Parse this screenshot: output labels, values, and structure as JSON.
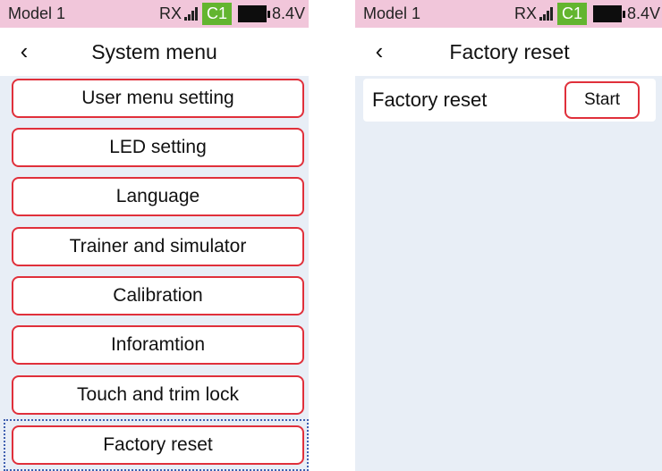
{
  "status": {
    "model": "Model 1",
    "rx": "RX",
    "channel": "C1",
    "voltage": "8.4V",
    "signal_icon": "signal-bars-icon",
    "battery_icon": "battery-full-icon",
    "colors": {
      "status_bg": "#f1c6da",
      "channel_bg": "#63b52f",
      "accent": "#e0303b"
    }
  },
  "left": {
    "back_icon": "chevron-left-icon",
    "title": "System menu",
    "items": [
      {
        "label": "User menu setting"
      },
      {
        "label": "LED setting"
      },
      {
        "label": "Language"
      },
      {
        "label": "Trainer and simulator"
      },
      {
        "label": "Calibration"
      },
      {
        "label": "Inforamtion"
      },
      {
        "label": "Touch and trim lock"
      },
      {
        "label": "Factory reset",
        "selected": true
      }
    ]
  },
  "right": {
    "back_icon": "chevron-left-icon",
    "title": "Factory reset",
    "row_label": "Factory reset",
    "start_label": "Start"
  }
}
